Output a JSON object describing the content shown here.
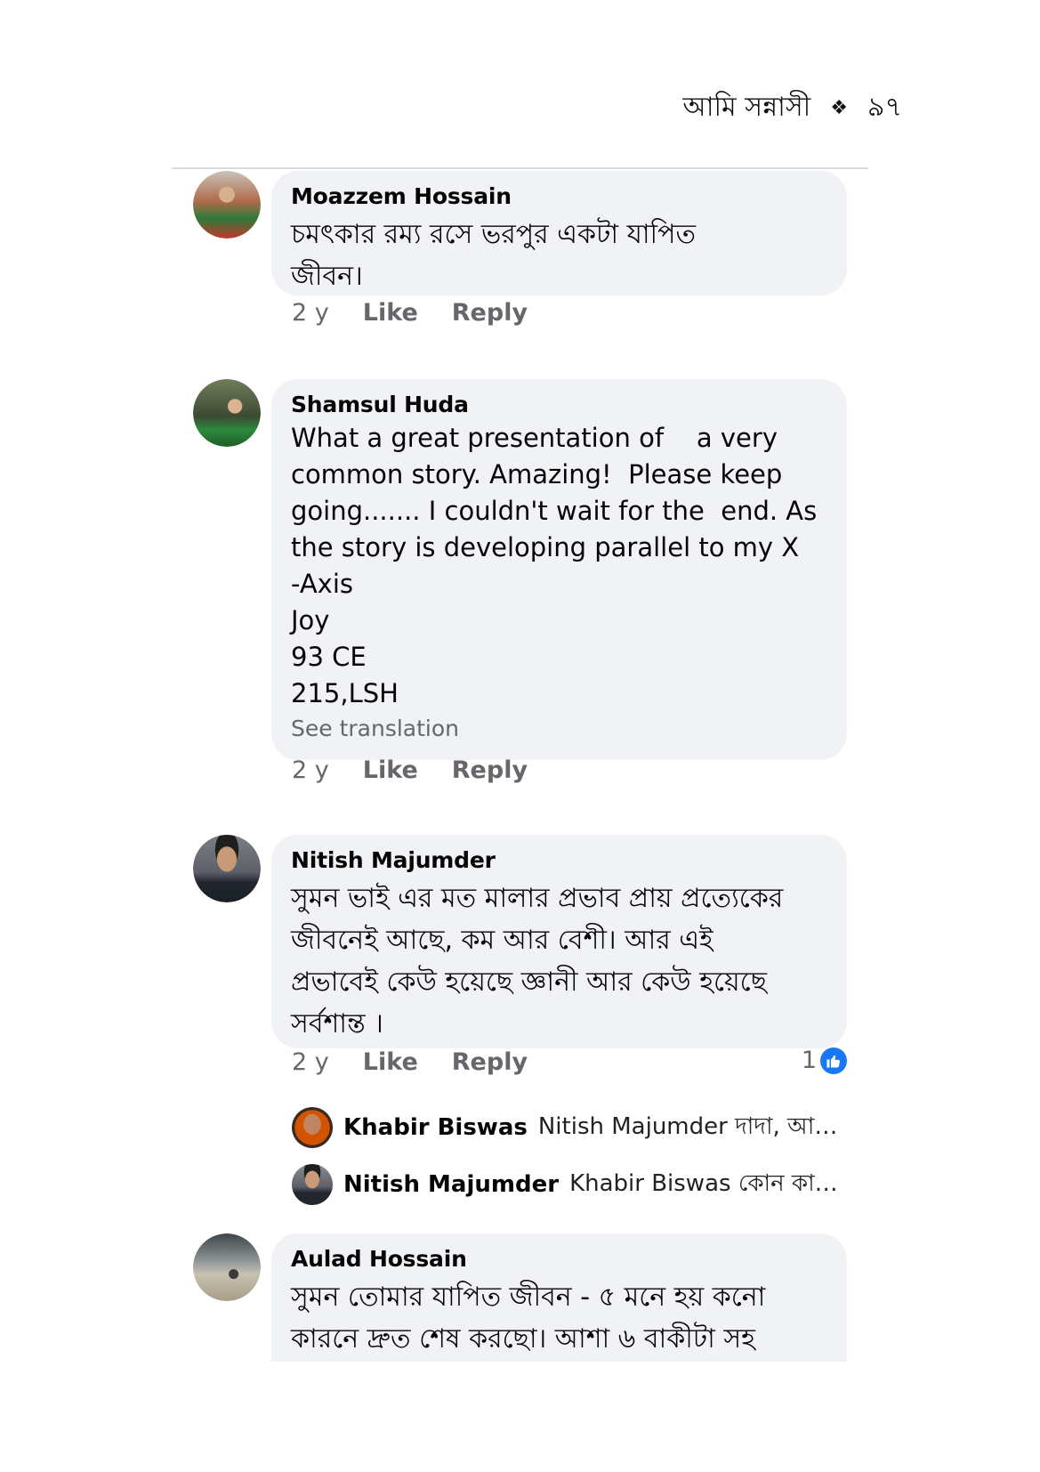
{
  "page_header": {
    "title": "আমি সন্নাসী",
    "ornament": "❖",
    "page_number": "৯৭"
  },
  "comments": [
    {
      "author": "Moazzem Hossain",
      "text_lines": [
        "চমৎকার রম্য রসে ভরপুর একটা যাপিত",
        "জীবন।"
      ],
      "time": "2 y",
      "like": "Like",
      "reply": "Reply"
    },
    {
      "author": "Shamsul Huda",
      "text_lines": [
        "What a great presentation of    a very",
        "common story. Amazing!  Please keep",
        "going....... I couldn't wait for the  end. As",
        "the story is developing parallel to my X",
        "-Axis",
        "Joy",
        "93 CE",
        "215,LSH"
      ],
      "see_translation": "See translation",
      "time": "2 y",
      "like": "Like",
      "reply": "Reply"
    },
    {
      "author": "Nitish Majumder",
      "text_lines": [
        "সুমন ভাই এর মত মালার প্রভাব প্রায় প্রত্যেকের",
        "জীবনেই আছে, কম আর বেশী। আর এই",
        "প্রভাবেই কেউ হয়েছে জ্ঞানী আর কেউ হয়েছে",
        "সর্বশান্ত ।"
      ],
      "time": "2 y",
      "like": "Like",
      "reply": "Reply",
      "reaction_count": "1",
      "replies": [
        {
          "author": "Khabir Biswas",
          "text": "Nitish Majumder দাদা, আপনি..."
        },
        {
          "author": "Nitish Majumder",
          "text": "Khabir Biswas কোন কাতা..."
        }
      ]
    },
    {
      "author": "Aulad Hossain",
      "text_lines": [
        "সুমন তোমার যাপিত জীবন - ৫ মনে হয় কনো",
        "কারনে দ্রুত শেষ করছো। আশা ৬ বাকীটা সহ"
      ]
    }
  ],
  "colors": {
    "bubble": "#f0f2f5",
    "meta": "#65676b",
    "like_blue": "#1877f2"
  }
}
